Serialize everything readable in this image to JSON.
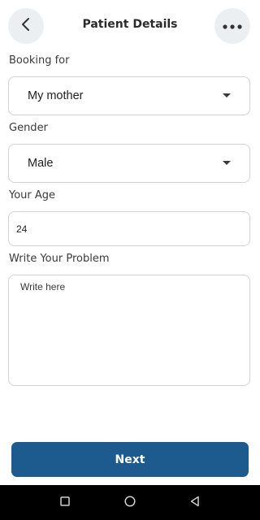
{
  "header": {
    "title": "Patient Details"
  },
  "form": {
    "booking_label": "Booking for",
    "booking_value": "My mother",
    "gender_label": "Gender",
    "gender_value": "Male",
    "age_label": "Your Age",
    "age_value": "24",
    "problem_label": "Write Your Problem",
    "problem_placeholder": "Write here"
  },
  "footer": {
    "next_label": "Next"
  },
  "colors": {
    "primary": "#1d5a8e",
    "icon_bg": "#eceff2",
    "border": "#cfd3d8"
  }
}
